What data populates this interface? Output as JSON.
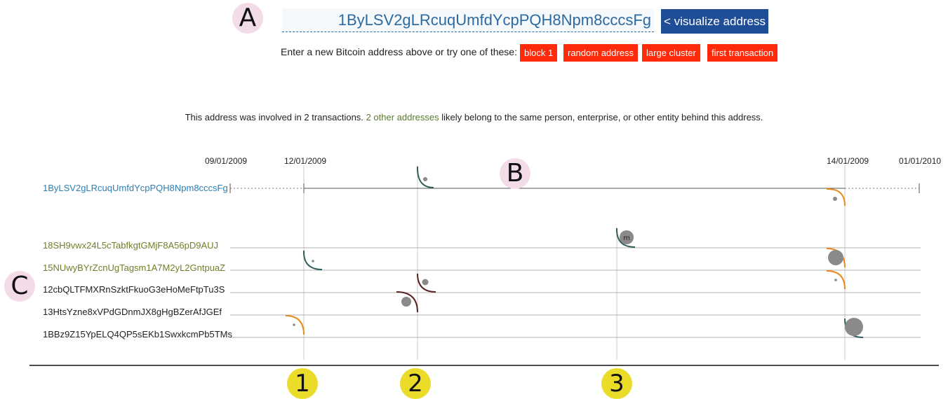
{
  "header": {
    "address_value": "1ByLSV2gLRcuqUmfdYcpPQH8Npm8cccsFg",
    "visualize_label": "< visualize address",
    "hint": "Enter a new Bitcoin address above or try one of these:",
    "examples": [
      "block 1",
      "random address",
      "large cluster",
      "first transaction"
    ]
  },
  "summary": {
    "pre": "This address was involved in 2 transactions.",
    "link": "2 other addresses",
    "post": "likely belong to the same person, enterprise, or other entity behind this address."
  },
  "timeline": {
    "dates": [
      "09/01/2009",
      "12/01/2009",
      "14/01/2009",
      "01/01/2010"
    ],
    "main_address": "1ByLSV2gLRcuqUmfdYcpPQH8Npm8cccsFg",
    "cluster_addresses": [
      "18SH9vwx24L5cTabfkgtGMjF8A56pD9AUJ",
      "15NUwyBYrZcnUgTagsm1A7M2yL2GntpuaZ"
    ],
    "other_addresses": [
      "12cbQLTFMXRnSzktFkuoG3eHoMeFtpTu3S",
      "13HtsYzne8xVPdGDnmJX8gHgBZerAfJGEf",
      "1BBz9Z15YpELQ4QP5sEKb1SwxkcmPb5TMs"
    ],
    "mining_marker": "m"
  },
  "annotations": {
    "letters": [
      "A",
      "B",
      "C"
    ],
    "numbers": [
      "1",
      "2",
      "3"
    ]
  },
  "colors": {
    "accent_blue": "#1f4e97",
    "example_red": "#ff2a0a",
    "teal": "#2e5f5a",
    "orange": "#e88a1a",
    "dark_red": "#5a2323",
    "node_gray": "#8a8a8a",
    "annotation_yellow": "#ecdc2a",
    "annotation_pink": "#f3dce7"
  }
}
